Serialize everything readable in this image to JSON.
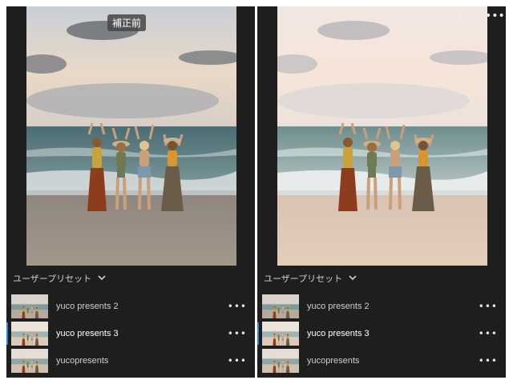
{
  "left": {
    "tag": "補正前",
    "section_label": "ユーザープリセット",
    "presets": [
      {
        "name": "yuco presents 2",
        "selected": false
      },
      {
        "name": "yuco presents 3",
        "selected": true
      },
      {
        "name": "yucopresents",
        "selected": false
      }
    ]
  },
  "right": {
    "section_label": "ユーザープリセット",
    "presets": [
      {
        "name": "yuco presents 2",
        "selected": false
      },
      {
        "name": "yuco presents 3",
        "selected": true
      },
      {
        "name": "yucopresents",
        "selected": false
      }
    ]
  },
  "icons": {
    "undo": "undo-icon",
    "more": "more-icon",
    "chevron": "chevron-down-icon"
  },
  "colors": {
    "panel_bg": "#1e1e1e",
    "selected_indicator": "#2b7fe0"
  }
}
